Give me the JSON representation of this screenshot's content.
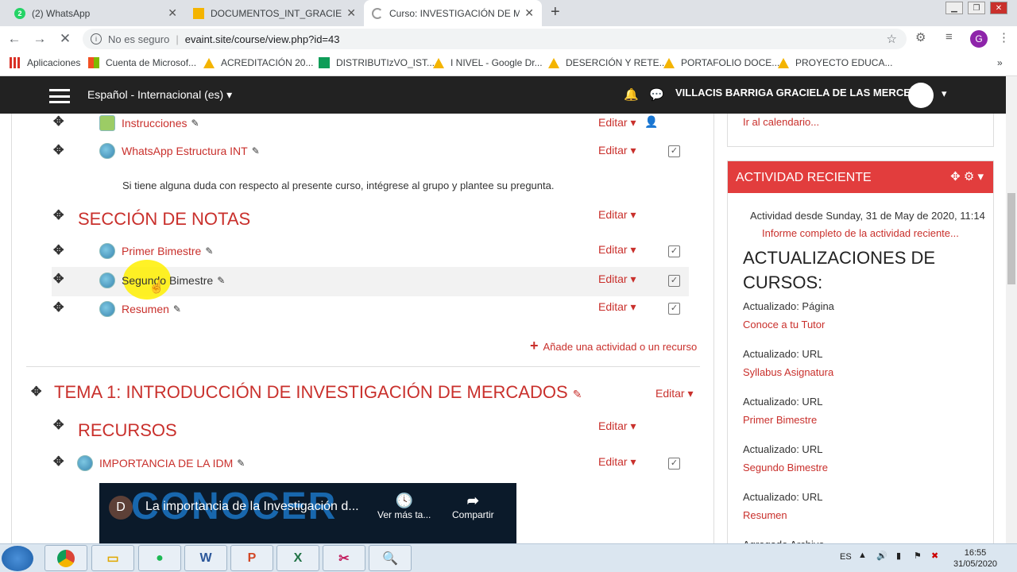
{
  "browser": {
    "tabs": [
      {
        "title": "(2) WhatsApp",
        "icon": "whatsapp-icon"
      },
      {
        "title": "DOCUMENTOS_INT_GRACIELA_V",
        "icon": "google-drive-icon"
      },
      {
        "title": "Curso: INVESTIGACIÓN DE MERC",
        "icon": "loading-icon"
      }
    ],
    "not_secure": "No es seguro",
    "url": "evaint.site/course/view.php?id=43",
    "profile_initial": "G",
    "bookmarks": [
      "Aplicaciones",
      "Cuenta de Microsof...",
      "ACREDITACIÓN 20...",
      "DISTRIBUTIzVO_IST...",
      "I NIVEL - Google Dr...",
      "DESERCIÓN Y RETE...",
      "PORTAFOLIO DOCE...",
      "PROYECTO EDUCA..."
    ]
  },
  "moodle": {
    "language": "Español - Internacional (es)",
    "user_name": "VILLACIS BARRIGA GRACIELA DE LAS MERCEDES",
    "edit_label": "Editar",
    "activities_top": [
      {
        "name": "Instrucciones"
      },
      {
        "name": "WhatsApp Estructura INT"
      }
    ],
    "group_note": "Si tiene alguna duda con respecto al presente curso, intégrese al grupo y plantee su pregunta.",
    "section_notas": "SECCIÓN DE NOTAS",
    "notas_items": [
      {
        "name": "Primer Bimestre"
      },
      {
        "name": "Segundo Bimestre"
      },
      {
        "name": "Resumen"
      }
    ],
    "add_activity": "Añade una actividad o un recurso",
    "topic1": "TEMA 1: INTRODUCCIÓN DE INVESTIGACIÓN DE MERCADOS",
    "recursos": "RECURSOS",
    "recurso_item": "IMPORTANCIA DE LA IDM",
    "video": {
      "channel_initial": "D",
      "title": "La importancia de la Investigación d...",
      "watch_later": "Ver más ta...",
      "share": "Compartir",
      "thumb_text": "CONOCER"
    }
  },
  "right": {
    "calendar_link": "Ir al calendario...",
    "block_title": "ACTIVIDAD RECIENTE",
    "since": "Actividad desde Sunday, 31 de May de 2020, 11:14",
    "full_report": "Informe completo de la actividad reciente...",
    "updates_title": "ACTUALIZACIONES DE CURSOS:",
    "updates": [
      {
        "label": "Actualizado: Página",
        "link": "Conoce a tu Tutor"
      },
      {
        "label": "Actualizado: URL",
        "link": "Syllabus Asignatura"
      },
      {
        "label": "Actualizado: URL",
        "link": "Primer Bimestre"
      },
      {
        "label": "Actualizado: URL",
        "link": "Segundo Bimestre"
      },
      {
        "label": "Actualizado: URL",
        "link": "Resumen"
      }
    ],
    "cut_text": "Agregado Archivo"
  },
  "taskbar": {
    "lang": "ES",
    "time": "16:55",
    "date": "31/05/2020"
  },
  "colors": {
    "accent": "#c9302c",
    "block_header": "#e23d3d",
    "navbar": "#222222"
  }
}
